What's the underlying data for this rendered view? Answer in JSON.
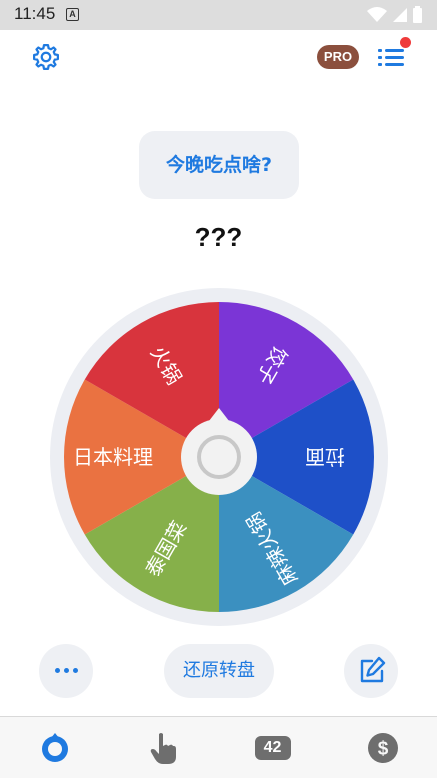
{
  "status_bar": {
    "time": "11:45",
    "notification_letter": "A"
  },
  "header": {
    "settings_icon": "gear-icon",
    "pro_label": "PRO",
    "menu_icon": "list-icon",
    "has_notification": true
  },
  "question": "今晚吃点啥?",
  "result": "???",
  "wheel": {
    "options": [
      {
        "label": "饺子",
        "color": "#7b35d6"
      },
      {
        "label": "拉面",
        "color": "#1e50c8"
      },
      {
        "label": "麻辣火锅",
        "color": "#3b90c0"
      },
      {
        "label": "泰国菜",
        "color": "#86b04a"
      },
      {
        "label": "日本料理",
        "color": "#ea7241"
      },
      {
        "label": "火锅",
        "color": "#d8343d"
      }
    ]
  },
  "actions": {
    "more_icon": "more-icon",
    "restore_label": "还原转盘",
    "edit_icon": "edit-icon"
  },
  "bottom_nav": [
    {
      "name": "wheel",
      "icon": "spinner-icon",
      "active": true
    },
    {
      "name": "tap",
      "icon": "finger-tap-icon"
    },
    {
      "name": "number",
      "icon": "number-icon",
      "label": "42"
    },
    {
      "name": "coin",
      "icon": "dollar-icon"
    }
  ],
  "colors": {
    "accent": "#1f7ae0",
    "pro_badge": "#8b4f3d",
    "notification": "#ef3b3b"
  }
}
